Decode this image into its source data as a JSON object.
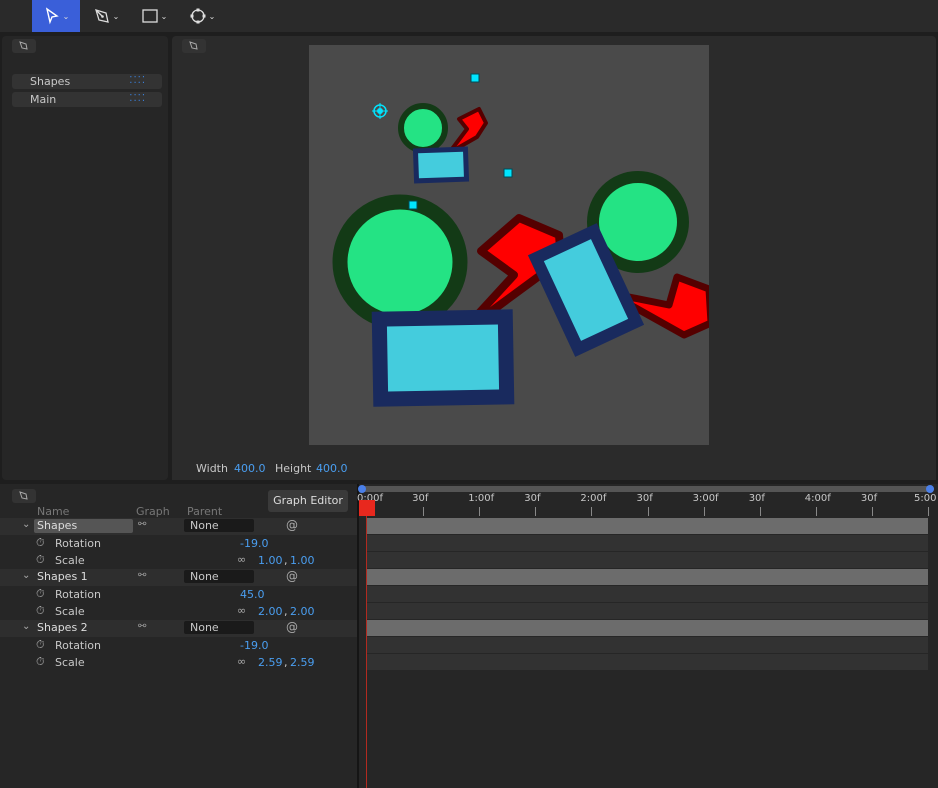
{
  "toolbar": {
    "tools": [
      {
        "icon": "select-arrow-icon",
        "active": true
      },
      {
        "icon": "pen-tool-icon",
        "active": false
      },
      {
        "icon": "rectangle-tool-icon",
        "active": false
      },
      {
        "icon": "anchor-point-icon",
        "active": false
      }
    ]
  },
  "layers_panel": {
    "items": [
      {
        "label": "Shapes",
        "icon": "select-bounds-icon"
      },
      {
        "label": "Main",
        "icon": "select-bounds-icon"
      }
    ]
  },
  "canvas": {
    "background": "#4a4a4a",
    "width_label": "Width",
    "width_value": "400.0",
    "height_label": "Height",
    "height_value": "400.0",
    "colors": {
      "circle_fill": "#24e384",
      "circle_stroke": "#133a16",
      "rect_fill": "#44ccdd",
      "rect_stroke": "#192a5e",
      "star_fill": "#ff0000",
      "star_stroke": "#550000",
      "handle": "#00e5ff"
    }
  },
  "timeline": {
    "headers": {
      "name": "Name",
      "graph": "Graph",
      "parent": "Parent"
    },
    "graph_editor_label": "Graph Editor",
    "ticks": [
      "0:00f",
      "30f",
      "1:00f",
      "30f",
      "2:00f",
      "30f",
      "3:00f",
      "30f",
      "4:00f",
      "30f",
      "5:00"
    ],
    "layers": [
      {
        "name": "Shapes",
        "parent": "None",
        "rotation_label": "Rotation",
        "rotation": "-19.0",
        "scale_label": "Scale",
        "scale_x": "1.00",
        "scale_y": "1.00"
      },
      {
        "name": "Shapes 1",
        "parent": "None",
        "rotation_label": "Rotation",
        "rotation": "45.0",
        "scale_label": "Scale",
        "scale_x": "2.00",
        "scale_y": "2.00"
      },
      {
        "name": "Shapes 2",
        "parent": "None",
        "rotation_label": "Rotation",
        "rotation": "-19.0",
        "scale_label": "Scale",
        "scale_x": "2.59",
        "scale_y": "2.59"
      }
    ],
    "colors": {
      "playhead": "#e8281e",
      "range_bar": "#4a7fe8"
    }
  }
}
